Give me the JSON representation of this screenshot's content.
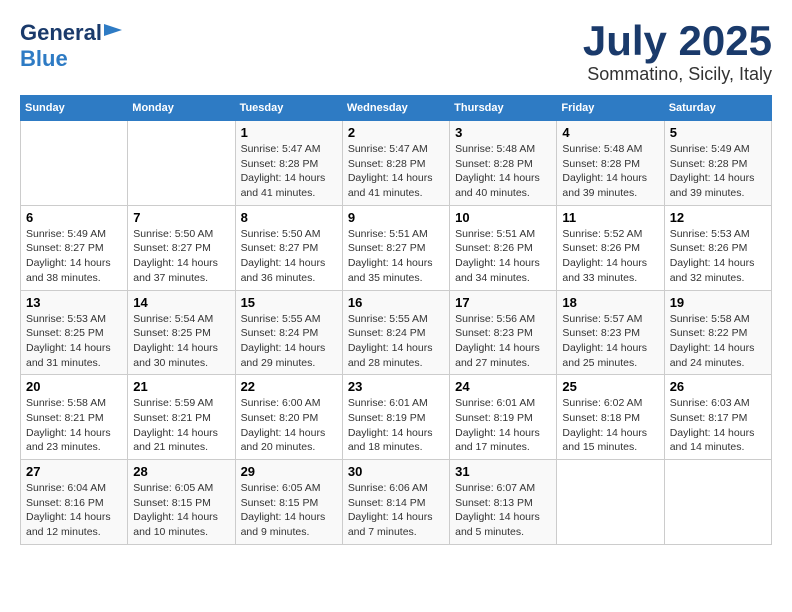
{
  "header": {
    "logo_general": "General",
    "logo_blue": "Blue",
    "month": "July 2025",
    "location": "Sommatino, Sicily, Italy"
  },
  "days_of_week": [
    "Sunday",
    "Monday",
    "Tuesday",
    "Wednesday",
    "Thursday",
    "Friday",
    "Saturday"
  ],
  "weeks": [
    [
      {
        "day": "",
        "content": ""
      },
      {
        "day": "",
        "content": ""
      },
      {
        "day": "1",
        "content": "Sunrise: 5:47 AM\nSunset: 8:28 PM\nDaylight: 14 hours and 41 minutes."
      },
      {
        "day": "2",
        "content": "Sunrise: 5:47 AM\nSunset: 8:28 PM\nDaylight: 14 hours and 41 minutes."
      },
      {
        "day": "3",
        "content": "Sunrise: 5:48 AM\nSunset: 8:28 PM\nDaylight: 14 hours and 40 minutes."
      },
      {
        "day": "4",
        "content": "Sunrise: 5:48 AM\nSunset: 8:28 PM\nDaylight: 14 hours and 39 minutes."
      },
      {
        "day": "5",
        "content": "Sunrise: 5:49 AM\nSunset: 8:28 PM\nDaylight: 14 hours and 39 minutes."
      }
    ],
    [
      {
        "day": "6",
        "content": "Sunrise: 5:49 AM\nSunset: 8:27 PM\nDaylight: 14 hours and 38 minutes."
      },
      {
        "day": "7",
        "content": "Sunrise: 5:50 AM\nSunset: 8:27 PM\nDaylight: 14 hours and 37 minutes."
      },
      {
        "day": "8",
        "content": "Sunrise: 5:50 AM\nSunset: 8:27 PM\nDaylight: 14 hours and 36 minutes."
      },
      {
        "day": "9",
        "content": "Sunrise: 5:51 AM\nSunset: 8:27 PM\nDaylight: 14 hours and 35 minutes."
      },
      {
        "day": "10",
        "content": "Sunrise: 5:51 AM\nSunset: 8:26 PM\nDaylight: 14 hours and 34 minutes."
      },
      {
        "day": "11",
        "content": "Sunrise: 5:52 AM\nSunset: 8:26 PM\nDaylight: 14 hours and 33 minutes."
      },
      {
        "day": "12",
        "content": "Sunrise: 5:53 AM\nSunset: 8:26 PM\nDaylight: 14 hours and 32 minutes."
      }
    ],
    [
      {
        "day": "13",
        "content": "Sunrise: 5:53 AM\nSunset: 8:25 PM\nDaylight: 14 hours and 31 minutes."
      },
      {
        "day": "14",
        "content": "Sunrise: 5:54 AM\nSunset: 8:25 PM\nDaylight: 14 hours and 30 minutes."
      },
      {
        "day": "15",
        "content": "Sunrise: 5:55 AM\nSunset: 8:24 PM\nDaylight: 14 hours and 29 minutes."
      },
      {
        "day": "16",
        "content": "Sunrise: 5:55 AM\nSunset: 8:24 PM\nDaylight: 14 hours and 28 minutes."
      },
      {
        "day": "17",
        "content": "Sunrise: 5:56 AM\nSunset: 8:23 PM\nDaylight: 14 hours and 27 minutes."
      },
      {
        "day": "18",
        "content": "Sunrise: 5:57 AM\nSunset: 8:23 PM\nDaylight: 14 hours and 25 minutes."
      },
      {
        "day": "19",
        "content": "Sunrise: 5:58 AM\nSunset: 8:22 PM\nDaylight: 14 hours and 24 minutes."
      }
    ],
    [
      {
        "day": "20",
        "content": "Sunrise: 5:58 AM\nSunset: 8:21 PM\nDaylight: 14 hours and 23 minutes."
      },
      {
        "day": "21",
        "content": "Sunrise: 5:59 AM\nSunset: 8:21 PM\nDaylight: 14 hours and 21 minutes."
      },
      {
        "day": "22",
        "content": "Sunrise: 6:00 AM\nSunset: 8:20 PM\nDaylight: 14 hours and 20 minutes."
      },
      {
        "day": "23",
        "content": "Sunrise: 6:01 AM\nSunset: 8:19 PM\nDaylight: 14 hours and 18 minutes."
      },
      {
        "day": "24",
        "content": "Sunrise: 6:01 AM\nSunset: 8:19 PM\nDaylight: 14 hours and 17 minutes."
      },
      {
        "day": "25",
        "content": "Sunrise: 6:02 AM\nSunset: 8:18 PM\nDaylight: 14 hours and 15 minutes."
      },
      {
        "day": "26",
        "content": "Sunrise: 6:03 AM\nSunset: 8:17 PM\nDaylight: 14 hours and 14 minutes."
      }
    ],
    [
      {
        "day": "27",
        "content": "Sunrise: 6:04 AM\nSunset: 8:16 PM\nDaylight: 14 hours and 12 minutes."
      },
      {
        "day": "28",
        "content": "Sunrise: 6:05 AM\nSunset: 8:15 PM\nDaylight: 14 hours and 10 minutes."
      },
      {
        "day": "29",
        "content": "Sunrise: 6:05 AM\nSunset: 8:15 PM\nDaylight: 14 hours and 9 minutes."
      },
      {
        "day": "30",
        "content": "Sunrise: 6:06 AM\nSunset: 8:14 PM\nDaylight: 14 hours and 7 minutes."
      },
      {
        "day": "31",
        "content": "Sunrise: 6:07 AM\nSunset: 8:13 PM\nDaylight: 14 hours and 5 minutes."
      },
      {
        "day": "",
        "content": ""
      },
      {
        "day": "",
        "content": ""
      }
    ]
  ]
}
